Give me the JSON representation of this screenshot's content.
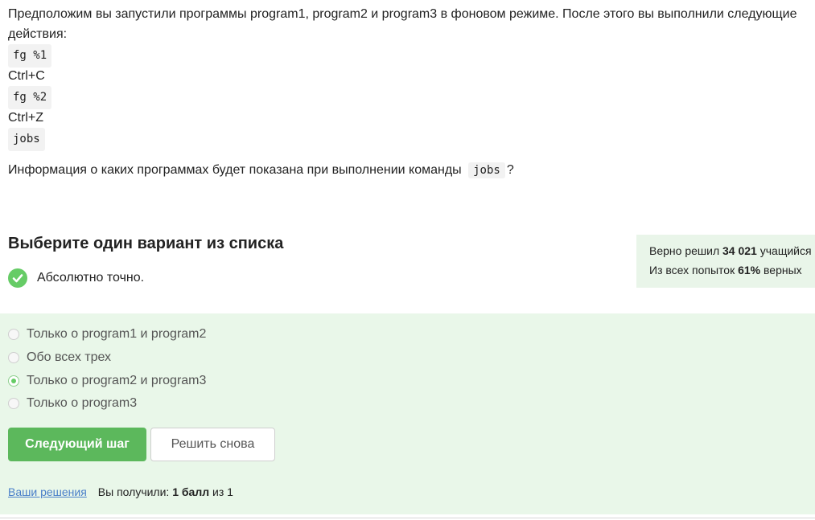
{
  "question": {
    "intro": "Предположим вы запустили программы program1, program2 и program3 в фоновом режиме. После этого вы выполнили следующие действия:",
    "steps": [
      {
        "kind": "code",
        "text": "fg %1"
      },
      {
        "kind": "text",
        "text": "Ctrl+C"
      },
      {
        "kind": "code",
        "text": "fg %2"
      },
      {
        "kind": "text",
        "text": "Ctrl+Z"
      },
      {
        "kind": "code",
        "text": "jobs"
      }
    ],
    "ask_before": "Информация о каких программах будет показана при выполнении команды",
    "ask_code": "jobs",
    "ask_after": "?"
  },
  "section_title": "Выберите один вариант из списка",
  "result": {
    "text": "Абсолютно точно.",
    "icon": "check-icon",
    "color": "#66cc66"
  },
  "stats": {
    "line1_prefix": "Верно решил",
    "line1_value": "34 021",
    "line1_suffix": "учащийся",
    "line2_prefix": "Из всех попыток",
    "line2_value": "61%",
    "line2_suffix": "верных"
  },
  "options": [
    {
      "label": "Только о program1 и program2",
      "selected": false
    },
    {
      "label": "Обо всех трех",
      "selected": false
    },
    {
      "label": "Только о program2 и program3",
      "selected": true
    },
    {
      "label": "Только о program3",
      "selected": false
    }
  ],
  "buttons": {
    "next": "Следующий шаг",
    "retry": "Решить снова"
  },
  "footer": {
    "link": "Ваши решения",
    "score_prefix": "Вы получили:",
    "score_value": "1 балл",
    "score_suffix": "из 1"
  },
  "colors": {
    "accent": "#5cb85c",
    "panel": "#e9f7e9",
    "link": "#4a7fc9"
  }
}
